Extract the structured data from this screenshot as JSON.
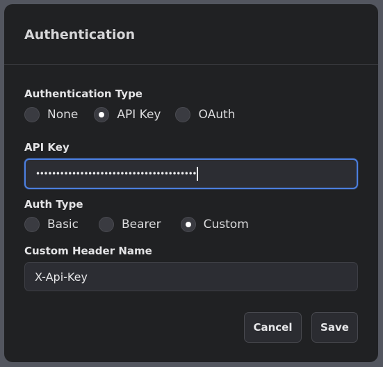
{
  "dialog": {
    "title": "Authentication"
  },
  "auth_type": {
    "label": "Authentication Type",
    "options": [
      {
        "label": "None",
        "selected": false
      },
      {
        "label": "API Key",
        "selected": true
      },
      {
        "label": "OAuth",
        "selected": false
      }
    ]
  },
  "api_key": {
    "label": "API Key",
    "value": "••••••••••••••••••••••••••••••••••••••••"
  },
  "header_type": {
    "label": "Auth Type",
    "options": [
      {
        "label": "Basic",
        "selected": false
      },
      {
        "label": "Bearer",
        "selected": false
      },
      {
        "label": "Custom",
        "selected": true
      }
    ]
  },
  "custom_header": {
    "label": "Custom Header Name",
    "value": "X-Api-Key"
  },
  "actions": {
    "cancel_label": "Cancel",
    "save_label": "Save"
  },
  "colors": {
    "dialog_bg": "#202123",
    "backdrop": "#53565f",
    "focus_ring": "#4c7fe0",
    "radio_dot": "#ffffff"
  }
}
